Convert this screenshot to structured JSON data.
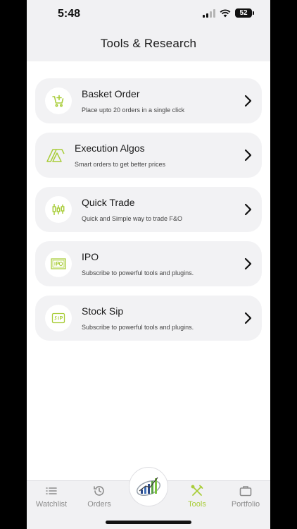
{
  "status_bar": {
    "time": "5:48",
    "battery": "52"
  },
  "header": {
    "title": "Tools & Research"
  },
  "colors": {
    "accent": "#a9cd3a",
    "card_bg": "#f2f2f4",
    "header_bg": "#f1f1f3"
  },
  "tools": [
    {
      "title": "Basket Order",
      "subtitle": "Place upto 20 orders in a single click",
      "icon": "cart-plus-icon"
    },
    {
      "title": "Execution Algos",
      "subtitle": "Smart orders to get better prices",
      "icon": "algo-icon"
    },
    {
      "title": "Quick Trade",
      "subtitle": "Quick and Simple way to trade F&O",
      "icon": "candlestick-icon"
    },
    {
      "title": "IPO",
      "subtitle": "Subscribe to powerful tools and plugins.",
      "icon": "ipo-icon"
    },
    {
      "title": "Stock Sip",
      "subtitle": "Subscribe to powerful tools and plugins.",
      "icon": "sip-icon"
    }
  ],
  "tabbar": {
    "watchlist": "Watchlist",
    "orders": "Orders",
    "tools": "Tools",
    "portfolio": "Portfolio"
  }
}
